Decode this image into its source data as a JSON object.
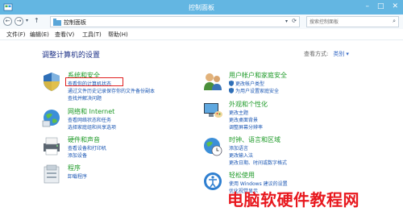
{
  "window": {
    "title": "控制面板"
  },
  "address": {
    "crumb": "控制面板",
    "search_placeholder": "搜索控制面板"
  },
  "menu": {
    "file": "文件(F)",
    "edit": "编辑(E)",
    "view": "查看(V)",
    "tools": "工具(T)",
    "help": "帮助(H)"
  },
  "main": {
    "title": "调整计算机的设置",
    "view_label": "查看方式:",
    "view_value": "类别"
  },
  "categories": {
    "system": {
      "heading": "系统和安全",
      "links": [
        "查看你的计算机状态",
        "通过文件历史记录保存你的文件备份副本",
        "查找并解决问题"
      ]
    },
    "network": {
      "heading": "网络和 Internet",
      "links": [
        "查看网络状态和任务",
        "选择家庭组和共享选项"
      ]
    },
    "hardware": {
      "heading": "硬件和声音",
      "links": [
        "查看设备和打印机",
        "添加设备"
      ]
    },
    "programs": {
      "heading": "程序",
      "links": [
        "卸载程序"
      ]
    },
    "accounts": {
      "heading": "用户帐户和家庭安全",
      "links": [
        "更改帐户类型",
        "为用户设置家庭安全"
      ]
    },
    "appearance": {
      "heading": "外观和个性化",
      "links": [
        "更改主题",
        "更改桌面背景",
        "调整屏幕分辨率"
      ]
    },
    "clock": {
      "heading": "时钟、语言和区域",
      "links": [
        "添加语言",
        "更改输入法",
        "更改日期、时间或数字格式"
      ]
    },
    "ease": {
      "heading": "轻松使用",
      "links": [
        "使用 Windows 建议的设置",
        "优化视觉显示"
      ]
    }
  },
  "watermark": "电脑软硬件教程网",
  "colors": {
    "titlebar": "#63b6e2",
    "heading": "#1e9a28",
    "link": "#1a56b3",
    "highlight": "#e02020",
    "main_title": "#1e3287"
  }
}
